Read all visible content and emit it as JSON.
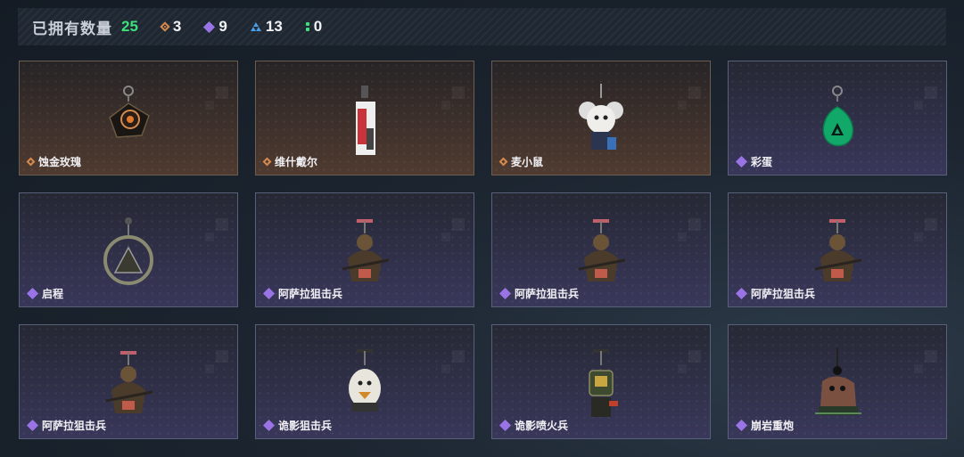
{
  "header": {
    "owned_label": "已拥有数量",
    "owned_count": "25",
    "stats": [
      {
        "icon": "gold-rarity-icon",
        "count": "3",
        "color": "#d58a4e"
      },
      {
        "icon": "purple-rarity-icon",
        "count": "9",
        "color": "#9a74e6"
      },
      {
        "icon": "blue-rarity-icon",
        "count": "13",
        "color": "#4a9ee8"
      },
      {
        "icon": "green-rarity-icon",
        "count": "0",
        "color": "#3ce07c"
      }
    ]
  },
  "charms": [
    {
      "name": "蚀金玫瑰",
      "rarity": "gold",
      "art": "rose"
    },
    {
      "name": "维什戴尔",
      "rarity": "gold",
      "art": "card"
    },
    {
      "name": "麦小鼠",
      "rarity": "gold",
      "art": "mouse"
    },
    {
      "name": "彩蛋",
      "rarity": "purple",
      "art": "egg"
    },
    {
      "name": "启程",
      "rarity": "purple",
      "art": "ring"
    },
    {
      "name": "阿萨拉狙击兵",
      "rarity": "purple",
      "art": "sniper"
    },
    {
      "name": "阿萨拉狙击兵",
      "rarity": "purple",
      "art": "sniper"
    },
    {
      "name": "阿萨拉狙击兵",
      "rarity": "purple",
      "art": "sniper"
    },
    {
      "name": "阿萨拉狙击兵",
      "rarity": "purple",
      "art": "sniper"
    },
    {
      "name": "诡影狙击兵",
      "rarity": "purple",
      "art": "ghost"
    },
    {
      "name": "诡影喷火兵",
      "rarity": "purple",
      "art": "flame"
    },
    {
      "name": "崩岩重炮",
      "rarity": "purple",
      "art": "heavy"
    }
  ],
  "colors": {
    "accent_green": "#3ce07c",
    "gold": "#d58a4e",
    "purple": "#9a74e6",
    "blue": "#4a9ee8"
  }
}
